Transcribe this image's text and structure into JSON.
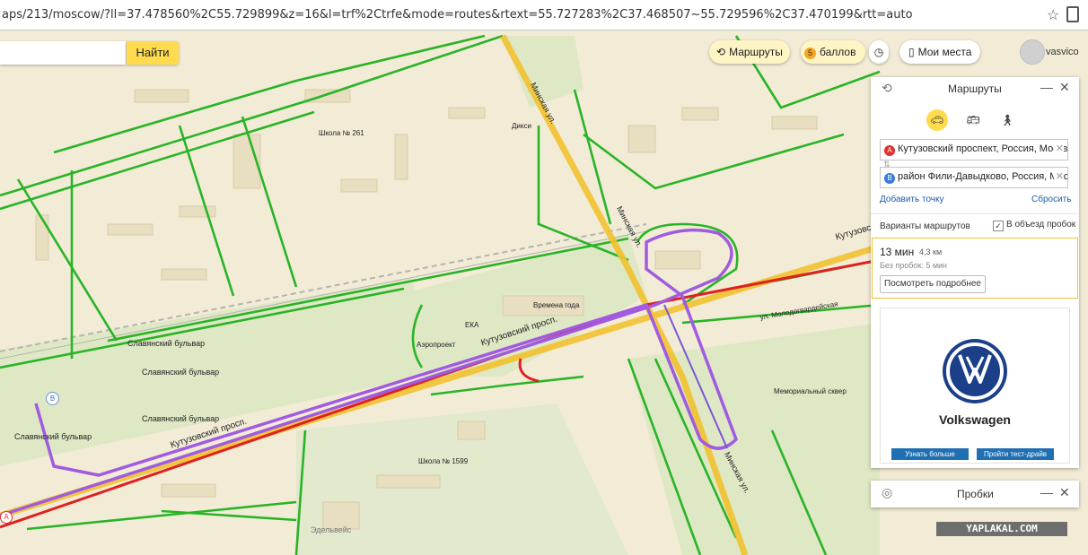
{
  "browser": {
    "url": "aps/213/moscow/?ll=37.478560%2C55.729899&z=16&l=trf%2Ctrfe&mode=routes&rtext=55.727283%2C37.468507~55.729596%2C37.470199&rtt=auto"
  },
  "toolbar": {
    "find_label": "Найти",
    "routes_label": "Маршруты",
    "points_badge": "5",
    "points_label": "баллов",
    "places_label": "Мои места",
    "username": "vasvico"
  },
  "route_panel": {
    "title": "Маршруты",
    "point_a_badge": "A",
    "point_a": "Кутузовский проспект, Россия, Москва",
    "point_b_badge": "B",
    "point_b": "район Фили-Давыдково, Россия, Москва",
    "add_point": "Добавить точку",
    "reset": "Сбросить",
    "variants_label": "Варианты маршрутов",
    "avoid_traffic_label": "В объезд пробок",
    "avoid_traffic_checked": true,
    "route_time": "13 мин",
    "route_distance": "4,3 км",
    "no_traffic": "Без пробок: 5 мин",
    "details_button": "Посмотреть подробнее",
    "ad": {
      "brand": "Volkswagen",
      "button_more": "Узнать больше",
      "button_test": "Пройти тест-драйв"
    }
  },
  "traffic_panel": {
    "title": "Пробки"
  },
  "watermark": "YAPLAKAL.COM",
  "map_labels": {
    "school_261": "Школа № 261",
    "school_1599": "Школа № 1599",
    "vremena_goda": "Времена года",
    "metro1": "Славянский бульвар",
    "metro2": "Славянский бульвар",
    "metro3": "Славянский бульвар",
    "metro4": "Славянский бульвар",
    "kutuzovsky1": "Кутузовский просп.",
    "kutuzovsky2": "Кутузовский просп.",
    "kutuzovsky3": "Кутузовский",
    "minskaya1": "Минская ул.",
    "minskaya2": "Минская ул.",
    "minskaya3": "Минская ул.",
    "molodogvard": "ул. Молодогвардейская",
    "memorial": "Мемориальный сквер",
    "edelveis": "Эдельвейс",
    "eka": "ЕКА",
    "dixy": "Дикси",
    "mosvodokanal": "Аэропроект"
  }
}
